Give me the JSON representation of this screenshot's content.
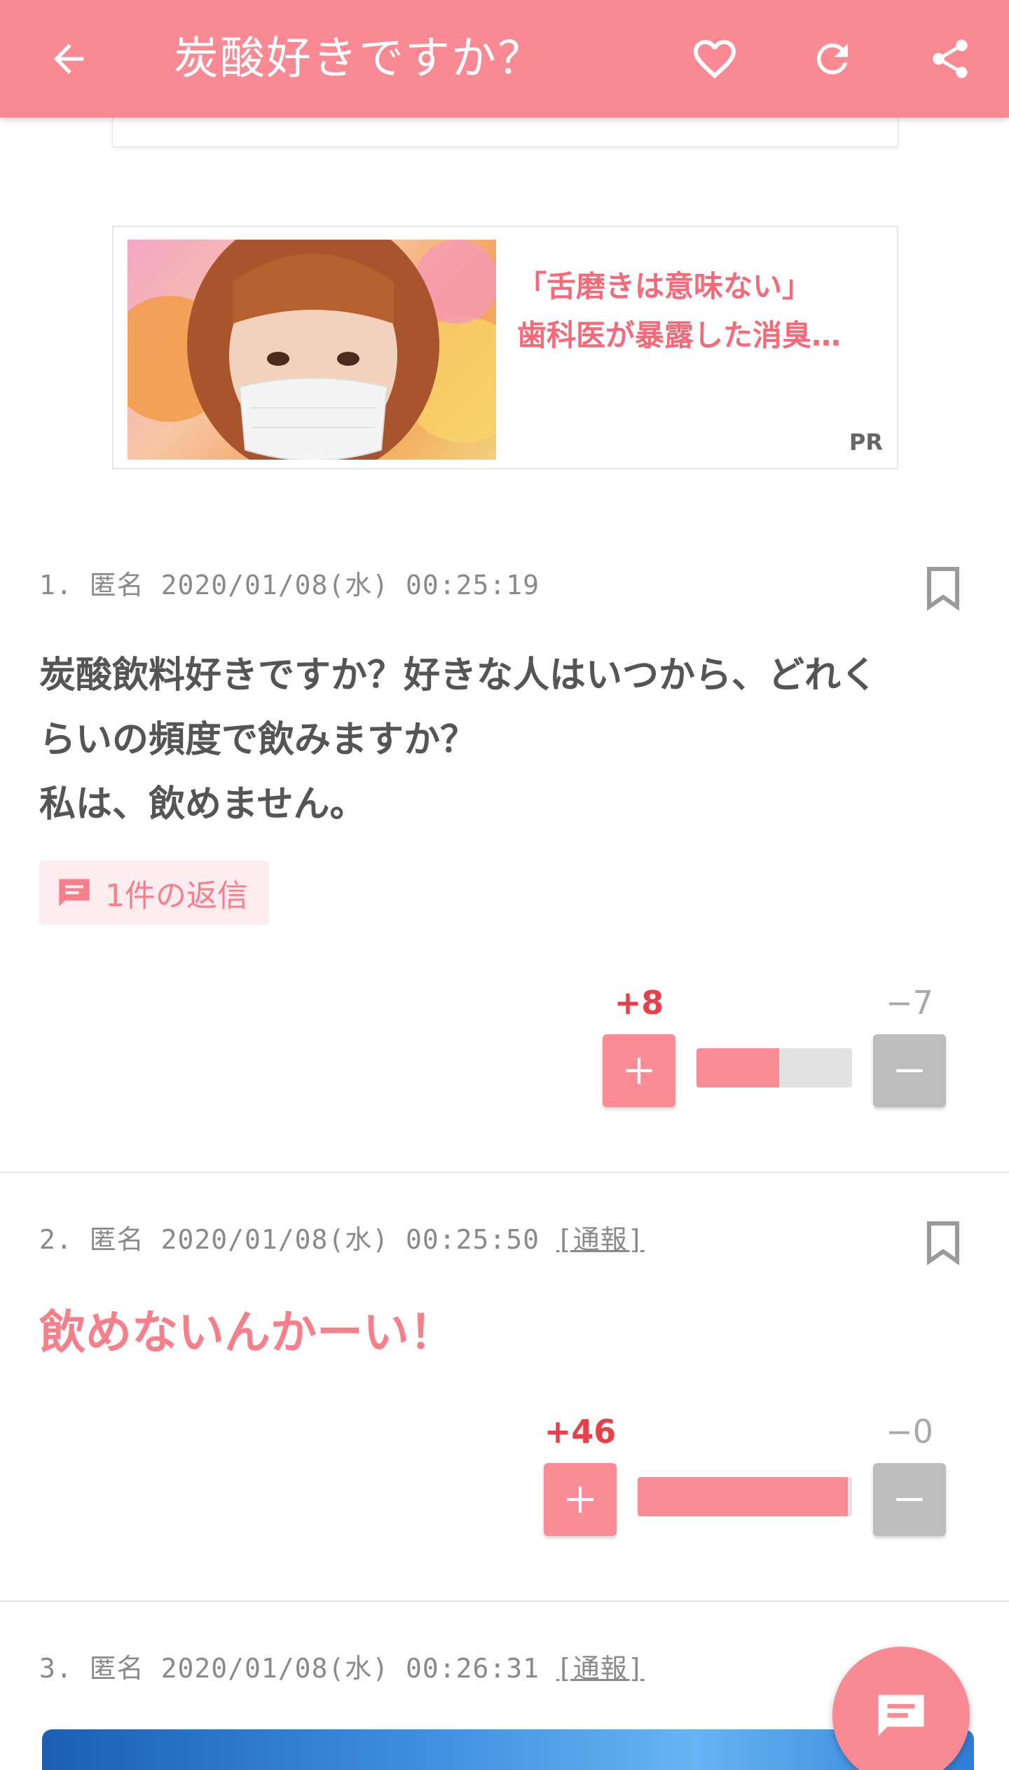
{
  "header": {
    "title": "炭酸好きですか？",
    "back_icon": "arrow-left-icon",
    "favorite_icon": "heart-icon",
    "reload_icon": "reload-icon",
    "share_icon": "share-icon",
    "bar_color": "#f98a93"
  },
  "ad": {
    "line1": "「舌磨きは意味ない」",
    "line2": "歯科医が暴露した消臭…",
    "pr_label": "PR",
    "text_color": "#f56a78"
  },
  "comments": [
    {
      "number": "1.",
      "author": "匿名",
      "datetime": "2020/01/08(水) 00:25:19",
      "report_label": "",
      "lines": [
        "炭酸飲料好きですか？好きな人はいつから、どれく",
        "らいの頻度で飲みますか？",
        "私は、飲めません。"
      ],
      "reply_label": "1件の返信",
      "plus_count": "+8",
      "minus_count": "−7",
      "plus_ratio": 0.53
    },
    {
      "number": "2.",
      "author": "匿名",
      "datetime": "2020/01/08(水) 00:25:50",
      "report_label": "[通報]",
      "text": "飲めないんかーい！",
      "plus_count": "+46",
      "minus_count": "−0",
      "plus_ratio": 0.98
    },
    {
      "number": "3.",
      "author": "匿名",
      "datetime": "2020/01/08(水) 00:26:31",
      "report_label": "[通報]"
    }
  ],
  "fab": {
    "icon": "comment-icon"
  },
  "colors": {
    "accent": "#f98a93",
    "plus": "#e8404a",
    "minus": "#bdbdbd"
  }
}
